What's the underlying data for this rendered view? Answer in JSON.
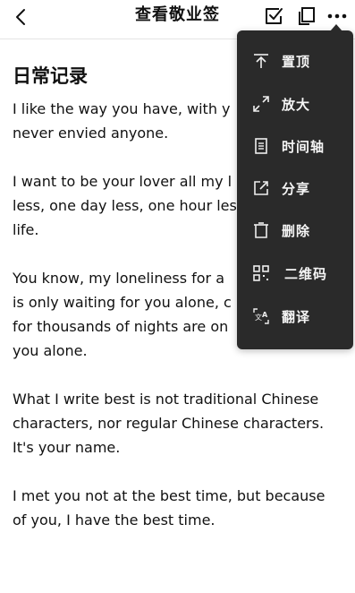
{
  "header": {
    "title": "查看敬业签"
  },
  "note": {
    "title": "日常记录",
    "paragraphs": [
      "I like the way you have, with y\nnever envied anyone.",
      "I want to be your lover all my l\nless, one day less, one hour les\nlife.",
      "You know, my loneliness for a\nis only waiting for you alone, c\nfor thousands of nights are on\nyou alone.",
      "What I write best is not traditional Chinese\ncharacters, nor regular Chinese characters.\nIt's your name.",
      "I met you not at the best time, but because\nof you, I have the best time."
    ]
  },
  "menu": {
    "items": [
      {
        "label": "置顶",
        "icon": "pin-top-icon"
      },
      {
        "label": "放大",
        "icon": "expand-icon"
      },
      {
        "label": "时间轴",
        "icon": "timeline-icon"
      },
      {
        "label": "分享",
        "icon": "share-icon"
      },
      {
        "label": "删除",
        "icon": "trash-icon"
      },
      {
        "label": "二维码",
        "icon": "qrcode-icon"
      },
      {
        "label": "翻译",
        "icon": "translate-icon"
      }
    ]
  },
  "colors": {
    "menu_bg": "#2a2a2a",
    "menu_text": "#f5f5f5",
    "text": "#111111"
  }
}
